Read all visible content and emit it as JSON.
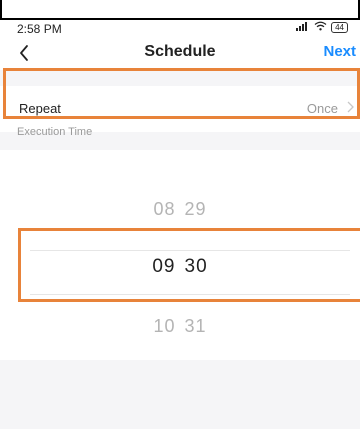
{
  "status_bar": {
    "time": "2:58 PM",
    "signal_icon": "signal-icon",
    "wifi_icon": "wifi-icon",
    "battery": "44"
  },
  "header": {
    "title": "Schedule",
    "back_icon": "chevron-left-icon",
    "next_label": "Next"
  },
  "repeat": {
    "label": "Repeat",
    "value": "Once",
    "chevron_icon": "chevron-right-icon"
  },
  "execution": {
    "label": "Execution Time"
  },
  "time_picker": {
    "previous": {
      "hour": "08",
      "minute": "29"
    },
    "selected": {
      "hour": "09",
      "minute": "30"
    },
    "next": {
      "hour": "10",
      "minute": "31"
    }
  },
  "colors": {
    "accent": "#1a8cff",
    "highlight": "#e8833a"
  }
}
